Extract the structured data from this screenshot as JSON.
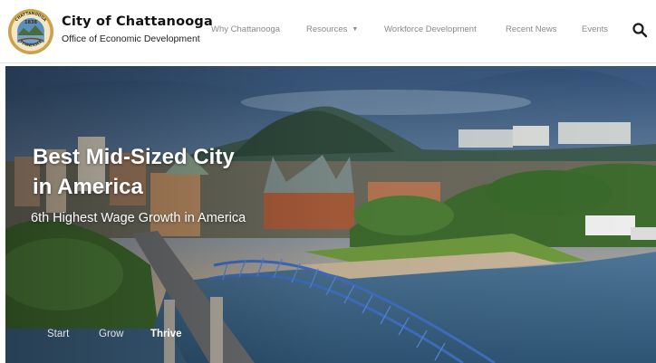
{
  "header": {
    "brand_title": "City of Chattanooga",
    "brand_subtitle": "Office of Economic Development",
    "seal": {
      "top_text": "CHATTANOOGA",
      "year": "1838",
      "bottom_text": "TENNESSEE"
    },
    "nav": [
      {
        "label": "Why Chattanooga",
        "has_dropdown": false
      },
      {
        "label": "Resources",
        "has_dropdown": true
      },
      {
        "label": "Workforce Development",
        "has_dropdown": false
      },
      {
        "label": "Recent News",
        "has_dropdown": false
      },
      {
        "label": "Events",
        "has_dropdown": false
      }
    ],
    "search_icon": "search-icon"
  },
  "hero": {
    "title_line1": "Best Mid-Sized City",
    "title_line2": "in America",
    "subtitle": "6th Highest Wage Growth in America",
    "tabs": [
      {
        "label": "Start",
        "active": false
      },
      {
        "label": "Grow",
        "active": false
      },
      {
        "label": "Thrive",
        "active": true
      }
    ]
  },
  "colors": {
    "nav_text": "#8a8a8a",
    "brand_text": "#111111",
    "hero_text": "#ffffff",
    "bridge": "#3f6fc0"
  }
}
